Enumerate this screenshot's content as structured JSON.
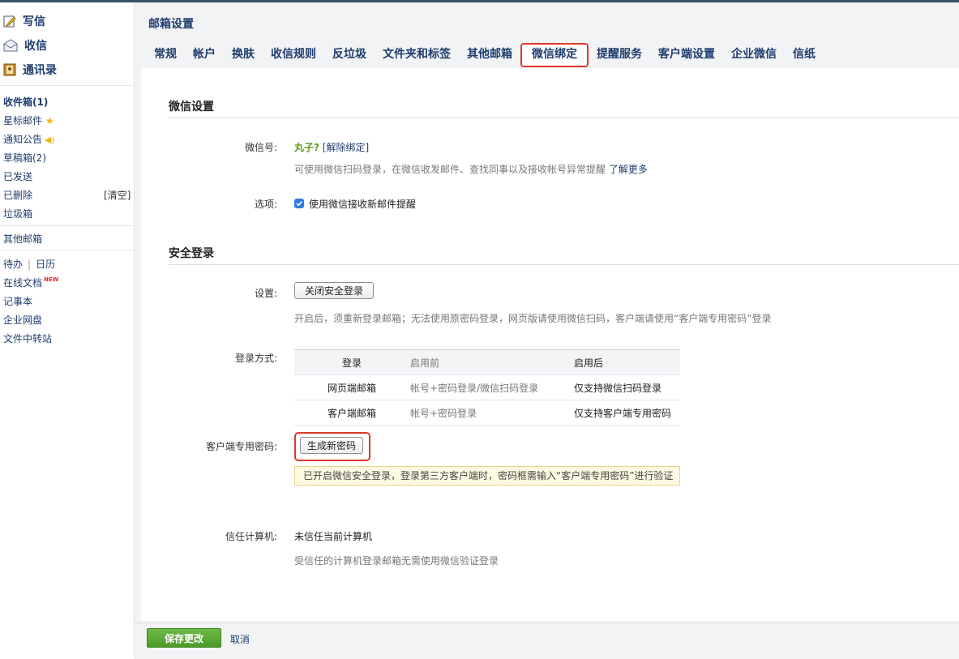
{
  "sidebar": {
    "compose": "写信",
    "receive": "收信",
    "contacts": "通讯录",
    "folders": {
      "inbox": "收件箱(1)",
      "starred": "星标邮件",
      "notice": "通知公告",
      "drafts": "草稿箱(2)",
      "sent": "已发送",
      "deleted": "已删除",
      "clear": "[清空]",
      "junk": "垃圾箱"
    },
    "other_mailbox": "其他邮箱",
    "todo": "待办",
    "calendar": "日历",
    "docs": "在线文档",
    "new_badge": "NEW",
    "notes": "记事本",
    "netdisk": "企业网盘",
    "transfer": "文件中转站"
  },
  "page": {
    "title": "邮箱设置"
  },
  "tabs": [
    "常规",
    "帐户",
    "换肤",
    "收信规则",
    "反垃圾",
    "文件夹和标签",
    "其他邮箱",
    "微信绑定",
    "提醒服务",
    "客户端设置",
    "企业微信",
    "信纸"
  ],
  "wechat_settings": {
    "heading": "微信设置",
    "account_label": "微信号:",
    "account_value": "丸子?",
    "unbind": "[解除绑定]",
    "desc": "可使用微信扫码登录，在微信收发邮件、查找同事以及接收帐号异常提醒",
    "learn_more": "了解更多",
    "options_label": "选项:",
    "option_text": "使用微信接收新邮件提醒"
  },
  "secure_login": {
    "heading": "安全登录",
    "setting_label": "设置:",
    "toggle_button": "关闭安全登录",
    "setting_desc": "开启后，须重新登录邮箱；无法使用原密码登录，网页版请使用微信扫码，客户端请使用“客户端专用密码”登录",
    "method_label": "登录方式:",
    "table": {
      "headers": [
        "登录",
        "启用前",
        "启用后"
      ],
      "rows": [
        [
          "网页端邮箱",
          "帐号+密码登录/微信扫码登录",
          "仅支持微信扫码登录"
        ],
        [
          "客户端邮箱",
          "帐号+密码登录",
          "仅支持客户端专用密码"
        ]
      ]
    },
    "client_pwd_label": "客户端专用密码:",
    "generate_button": "生成新密码",
    "notice": "已开启微信安全登录，登录第三方客户端时，密码框需输入“客户端专用密码”进行验证",
    "trusted_label": "信任计算机:",
    "trusted_value": "未信任当前计算机",
    "trusted_desc": "受信任的计算机登录邮箱无需使用微信验证登录"
  },
  "footer": {
    "save": "保存更改",
    "cancel": "取消"
  }
}
